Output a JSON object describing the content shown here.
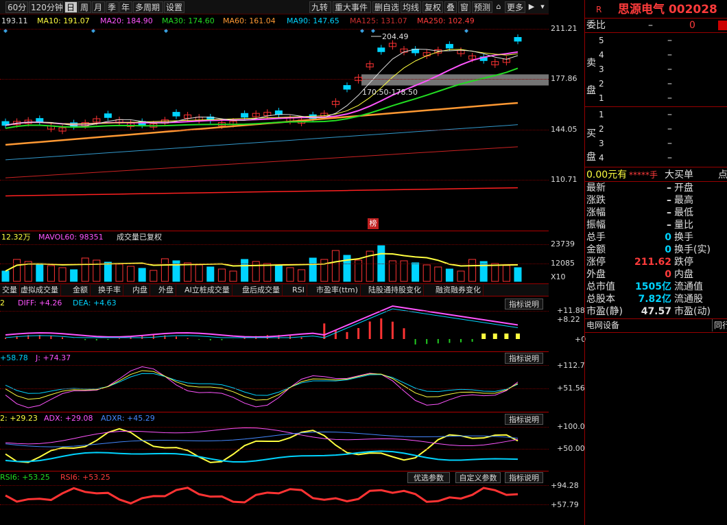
{
  "toolbar": {
    "periods": [
      "60分",
      "120分钟",
      "日",
      "周",
      "月",
      "季",
      "年",
      "多周期",
      "设置"
    ],
    "active_period": "日",
    "tools": [
      "九转",
      "重大事件",
      "删自选",
      "均线",
      "复权",
      "叠",
      "窗",
      "预测"
    ],
    "more_label": "更多"
  },
  "ma_legend": {
    "ma5": "193.11",
    "ma10": "MA10: 191.07",
    "ma20": "MA20: 184.90",
    "ma30": "MA30: 174.60",
    "ma60": "MA60: 161.04",
    "ma90": "MA90: 147.65",
    "ma125": "MA125: 131.07",
    "ma250": "MA250: 102.49"
  },
  "price_axis": [
    "211.21",
    "177.86",
    "144.05",
    "110.71"
  ],
  "annotations": {
    "high": "204.49",
    "range": "170.50-178.50",
    "badge": "榜"
  },
  "volume": {
    "legend_a": "12.32万",
    "legend_b": "MAVOL60: 98351",
    "legend_c": "成交量已复权",
    "axis": [
      "23739",
      "12085",
      "X10"
    ]
  },
  "tabs": [
    "交量",
    "虚拟成交量",
    "金额",
    "换手率",
    "内盘",
    "外盘",
    "AI立桩成交量",
    "盘后成交量",
    "RSI",
    "市盈率(ttm)",
    "陆股通持股变化",
    "融资融券变化"
  ],
  "explain_label": "指标说明",
  "macd": {
    "l1": "2",
    "diff": "DIFF: +4.26",
    "dea": "DEA: +4.63",
    "axis": [
      "+11.88",
      "+8.22",
      "+0"
    ]
  },
  "kdj": {
    "d": "+58.78",
    "j": "J: +74.37",
    "axis": [
      "+112.7",
      "+51.56"
    ]
  },
  "dmi": {
    "l1": "2: +29.23",
    "adx": "ADX: +29.08",
    "adxr": "ADXR: +45.29",
    "axis": [
      "+100.0",
      "+50.00"
    ]
  },
  "rsi": {
    "rsi1": "RSI6: +53.25",
    "rsi6": "RSI6: +53.25",
    "axis": [
      "+94.28",
      "+57.79"
    ],
    "btn_opt": "优选参数",
    "btn_custom": "自定义参数"
  },
  "quote": {
    "marker": "R",
    "name": "思源电气 002028",
    "webi_label": "委比",
    "webi_val": "–",
    "webi_num": "0",
    "sell_label": "卖盘",
    "buy_label": "买盘",
    "levels_sell": [
      "5",
      "4",
      "3",
      "2",
      "1"
    ],
    "levels_buy": [
      "1",
      "2",
      "3",
      "4"
    ],
    "dash": "–",
    "amount": "0.00元有",
    "hands": "*****手",
    "bigorder": "大买单",
    "dian": "点",
    "rows_left": [
      {
        "label": "最新",
        "val": "–"
      },
      {
        "label": "涨跌",
        "val": "–"
      },
      {
        "label": "涨幅",
        "val": "–"
      },
      {
        "label": "振幅",
        "val": "–"
      },
      {
        "label": "总手",
        "val": "0"
      },
      {
        "label": "金额",
        "val": "0"
      },
      {
        "label": "涨停",
        "val": "211.62"
      },
      {
        "label": "外盘",
        "val": "0"
      },
      {
        "label": "总市值",
        "val": "1505亿"
      },
      {
        "label": "总股本",
        "val": "7.82亿"
      },
      {
        "label": "市盈(静)",
        "val": "47.57"
      }
    ],
    "rows_right": [
      "开盘",
      "最高",
      "最低",
      "量比",
      "换手",
      "换手(实)",
      "跌停",
      "内盘",
      "流通值",
      "流通股",
      "市盈(动)"
    ],
    "tab1": "电网设备",
    "tab2": "同行"
  },
  "colors": {
    "up": "#ff3333",
    "down": "#00d4ff",
    "ma5": "#e0e0e0",
    "ma10": "#ffff40",
    "ma20": "#ff55ff",
    "ma30": "#22dd22",
    "ma60": "#ff9933",
    "ma90": "#3399cc",
    "ma125": "#cc2222",
    "ma250": "#ff2020"
  }
}
